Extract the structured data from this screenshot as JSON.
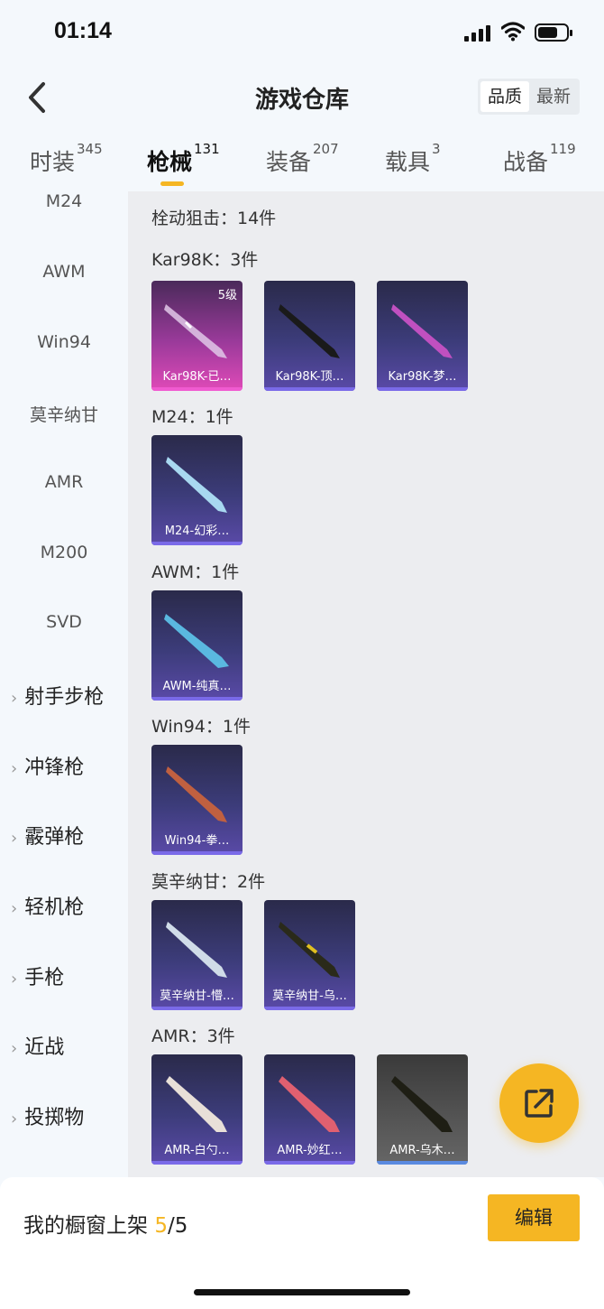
{
  "status": {
    "time": "01:14"
  },
  "nav": {
    "title": "游戏仓库",
    "sort": [
      "品质",
      "最新"
    ]
  },
  "tabs": [
    {
      "label": "时装",
      "count": "345"
    },
    {
      "label": "枪械",
      "count": "131"
    },
    {
      "label": "装备",
      "count": "207"
    },
    {
      "label": "载具",
      "count": "3"
    },
    {
      "label": "战备",
      "count": "119"
    }
  ],
  "sidebar": {
    "subitems": [
      "M24",
      "AWM",
      "Win94",
      "莫辛纳甘",
      "AMR",
      "M200",
      "SVD"
    ],
    "categories": [
      "射手步枪",
      "冲锋枪",
      "霰弹枪",
      "轻机枪",
      "手枪",
      "近战",
      "投掷物"
    ]
  },
  "main": {
    "header": "栓动狙击：14件",
    "groups": [
      {
        "title": "Kar98K：3件",
        "items": [
          {
            "label": "Kar98K-已…",
            "level": "5级",
            "style": "pink"
          },
          {
            "label": "Kar98K-顶…",
            "style": "purple"
          },
          {
            "label": "Kar98K-梦…",
            "style": "purple"
          }
        ]
      },
      {
        "title": "M24：1件",
        "items": [
          {
            "label": "M24-幻彩…",
            "style": "purple"
          }
        ]
      },
      {
        "title": "AWM：1件",
        "items": [
          {
            "label": "AWM-纯真…",
            "style": "purple"
          }
        ]
      },
      {
        "title": "Win94：1件",
        "items": [
          {
            "label": "Win94-拳…",
            "style": "purple"
          }
        ]
      },
      {
        "title": "莫辛纳甘：2件",
        "items": [
          {
            "label": "莫辛纳甘-懵…",
            "style": "purple"
          },
          {
            "label": "莫辛纳甘-乌…",
            "style": "purple"
          }
        ]
      },
      {
        "title": "AMR：3件",
        "items": [
          {
            "label": "AMR-白勺…",
            "style": "purple"
          },
          {
            "label": "AMR-妙红…",
            "style": "purple"
          },
          {
            "label": "AMR-乌木…",
            "style": "gray"
          }
        ]
      }
    ]
  },
  "bottom": {
    "shelf_label": "我的橱窗上架",
    "shelf_count": "5",
    "shelf_total": "/5",
    "edit_label": "编辑"
  },
  "colors": {
    "accent": "#f5b623",
    "card": "#3c3c7a",
    "pink": "#e04ab8"
  }
}
